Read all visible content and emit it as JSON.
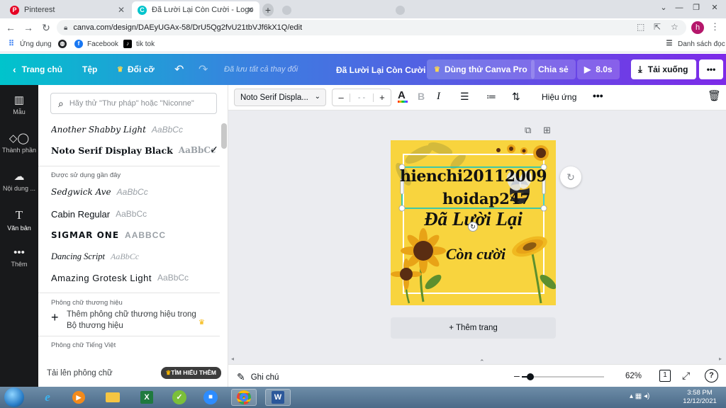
{
  "browser": {
    "tabs": [
      {
        "title": "Pinterest",
        "active": false
      },
      {
        "title": "Đã Lười Lại Còn Cười - Logo",
        "active": true
      },
      {
        "title": "",
        "active": false
      }
    ],
    "url": "canva.com/design/DAEyUGAx-58/DrU5Qg2fvU21tbVJf6kX1Q/edit",
    "avatar_letter": "h",
    "bookmarks": [
      {
        "label": "Ứng dụng",
        "icon": "apps-icon"
      },
      {
        "label": "",
        "icon": "globe-icon"
      },
      {
        "label": "Facebook",
        "icon": "facebook-icon"
      },
      {
        "label": "tik tok",
        "icon": "tiktok-icon"
      }
    ],
    "reading_list": "Danh sách đọc"
  },
  "header": {
    "home": "Trang chủ",
    "file": "Tệp",
    "resize": "Đổi cỡ",
    "saved": "Đã lưu tất cả thay đổi",
    "title": "Đã Lười Lại Còn Cười",
    "try_pro": "Dùng thử Canva Pro",
    "share": "Chia sẻ",
    "play": "8.0s",
    "download": "Tải xuống"
  },
  "rail": [
    {
      "label": "Mẫu",
      "icon": "templates-icon"
    },
    {
      "label": "Thành phần",
      "icon": "elements-icon"
    },
    {
      "label": "Nội dung ...",
      "icon": "uploads-icon"
    },
    {
      "label": "Văn bản",
      "icon": "text-icon",
      "active": true
    },
    {
      "label": "Thêm",
      "icon": "more-icon"
    }
  ],
  "panel": {
    "search_placeholder": "Hãy thử \"Thư pháp\" hoặc \"Niconne\"",
    "current_fonts": [
      {
        "name": "Another Shabby Light",
        "sample": "AaBbCc"
      },
      {
        "name": "Noto Serif Display Black",
        "sample": "AaBbCc",
        "selected": true
      }
    ],
    "recent_label": "Được sử dụng gần đây",
    "recent_fonts": [
      {
        "name": "Sedgwick Ave",
        "sample": "AaBbCc"
      },
      {
        "name": "Cabin Regular",
        "sample": "AaBbCc"
      },
      {
        "name": "Sigmar One",
        "sample": "AaBbCc"
      },
      {
        "name": "Dancing Script",
        "sample": "AaBbCc"
      },
      {
        "name": "Amazing Grotesk Light",
        "sample": "AaBbCc"
      }
    ],
    "brand_label": "Phông chữ thương hiệu",
    "brand_add": "Thêm phông chữ thương hiệu trong Bộ thương hiệu",
    "vietnamese_label": "Phông chữ Tiếng Việt",
    "upload": "Tải lên phông chữ",
    "learn_more": "TÌM HIỂU THÊM"
  },
  "toolbar": {
    "font": "Noto Serif Displa...",
    "size": "- -",
    "effects": "Hiệu ứng"
  },
  "design": {
    "text1": "hienchi20112009",
    "text2": "hoidap247",
    "text3": "Đã Lười Lại",
    "text4": "Còn cười",
    "background": "#f8d43e"
  },
  "canvas": {
    "add_page": "+ Thêm trang"
  },
  "bottom": {
    "notes": "Ghi chú",
    "zoom": "62%",
    "zoom_fraction": 0.1,
    "page_count": "1"
  },
  "taskbar": {
    "time": "3:58 PM",
    "date": "12/12/2021"
  },
  "colors": {
    "brand_teal": "#00c4cc",
    "brand_purple": "#7d2ae8",
    "rail_bg": "#18191b",
    "canvas_bg": "#ebecf0"
  }
}
